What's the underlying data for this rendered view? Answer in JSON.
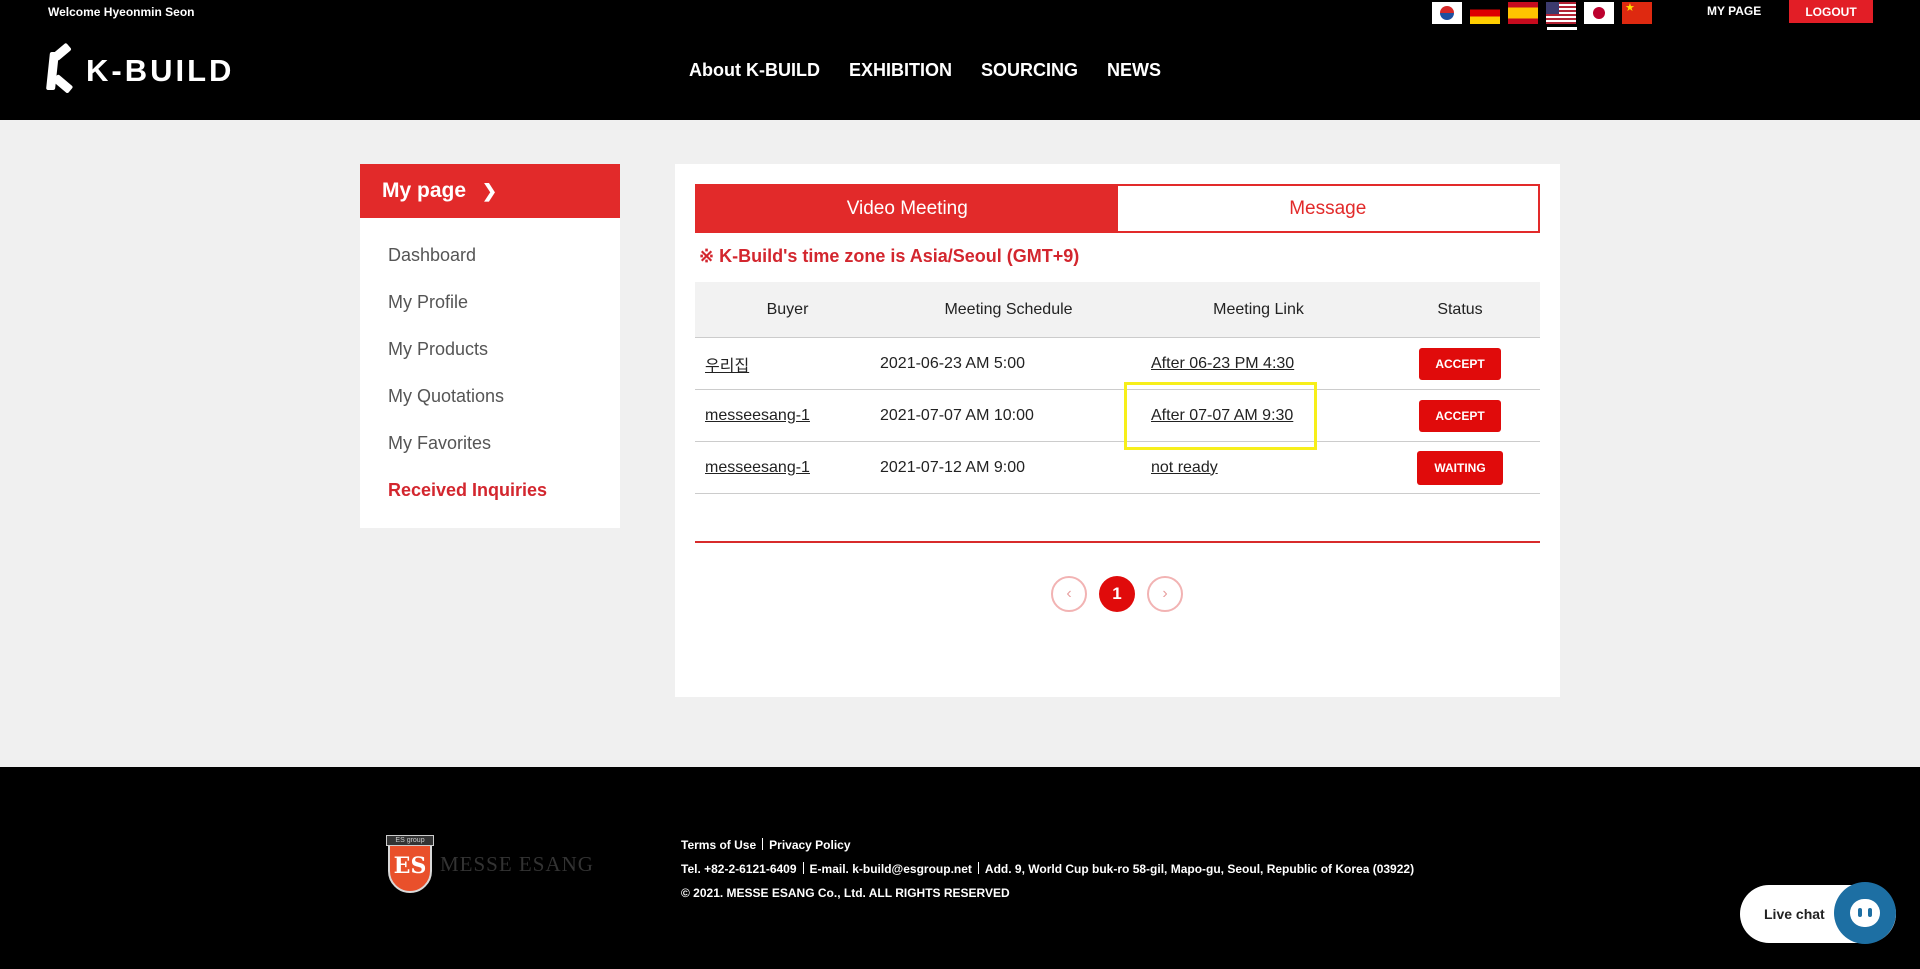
{
  "header": {
    "welcome": "Welcome Hyeonmin Seon",
    "logo": "K-BUILD",
    "nav": [
      "About K-BUILD",
      "EXHIBITION",
      "SOURCING",
      "NEWS"
    ],
    "my_page": "MY PAGE",
    "logout": "LOGOUT",
    "flags": [
      "korea-flag-icon",
      "germany-flag-icon",
      "spain-flag-icon",
      "usa-flag-icon",
      "japan-flag-icon",
      "china-flag-icon"
    ]
  },
  "sidebar": {
    "title": "My page",
    "items": [
      "Dashboard",
      "My Profile",
      "My Products",
      "My Quotations",
      "My Favorites",
      "Received Inquiries"
    ],
    "active": "Received Inquiries"
  },
  "main": {
    "tabs": [
      "Video Meeting",
      "Message"
    ],
    "active_tab": "Video Meeting",
    "timezone_note": "※ K-Build's time zone is Asia/Seoul (GMT+9)",
    "columns": [
      "Buyer",
      "Meeting Schedule",
      "Meeting Link",
      "Status"
    ],
    "rows": [
      {
        "buyer": "우리집",
        "schedule": "2021-06-23 AM 5:00",
        "link": "After 06-23 PM 4:30",
        "status": "ACCEPT"
      },
      {
        "buyer": "messeesang-1",
        "schedule": "2021-07-07 AM 10:00",
        "link": "After 07-07 AM 9:30",
        "status": "ACCEPT"
      },
      {
        "buyer": "messeesang-1",
        "schedule": "2021-07-12 AM 9:00",
        "link": "not ready",
        "status": "WAITING"
      }
    ],
    "pagination": {
      "prev": "‹",
      "current": "1",
      "next": "›"
    }
  },
  "footer": {
    "brand": "MESSE ESANG",
    "shield_band": "ES group",
    "shield_letters": "ES",
    "terms": "Terms of Use",
    "privacy": "Privacy Policy",
    "tel": "Tel. +82-2-6121-6409",
    "email": "E-mail. k-build@esgroup.net",
    "address": "Add. 9, World Cup buk-ro 58-gil, Mapo-gu, Seoul, Republic of Korea (03922)",
    "copyright": "© 2021. MESSE ESANG Co., Ltd. ALL RIGHTS RESERVED"
  },
  "livechat": {
    "label": "Live chat"
  },
  "colors": {
    "accent": "#e22a2a",
    "highlight": "#f7ef1a",
    "chat": "#1d6fa3"
  }
}
